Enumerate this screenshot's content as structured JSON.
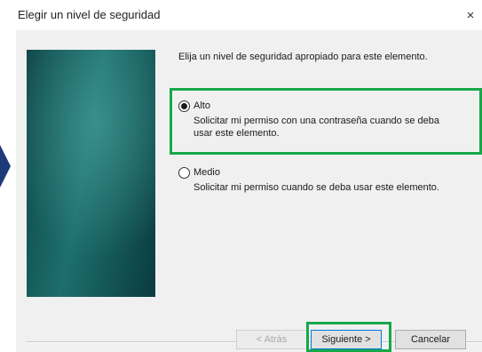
{
  "dialog": {
    "title": "Elegir un nivel de seguridad",
    "instruction": "Elija un nivel de seguridad apropiado para este elemento.",
    "options": [
      {
        "label": "Alto",
        "description": "Solicitar mi permiso con una contraseña cuando se deba usar este elemento.",
        "selected": true
      },
      {
        "label": "Medio",
        "description": "Solicitar mi permiso cuando se deba usar este elemento.",
        "selected": false
      }
    ],
    "buttons": {
      "back": "< Atrás",
      "next": "Siguiente >",
      "cancel": "Cancelar"
    }
  },
  "colors": {
    "highlight": "#17a84a",
    "banner": "#1d6f6d",
    "arrow": "#1f3a78"
  },
  "icons": {
    "close": "close-icon",
    "left_arrow": "chevron-right-icon"
  }
}
